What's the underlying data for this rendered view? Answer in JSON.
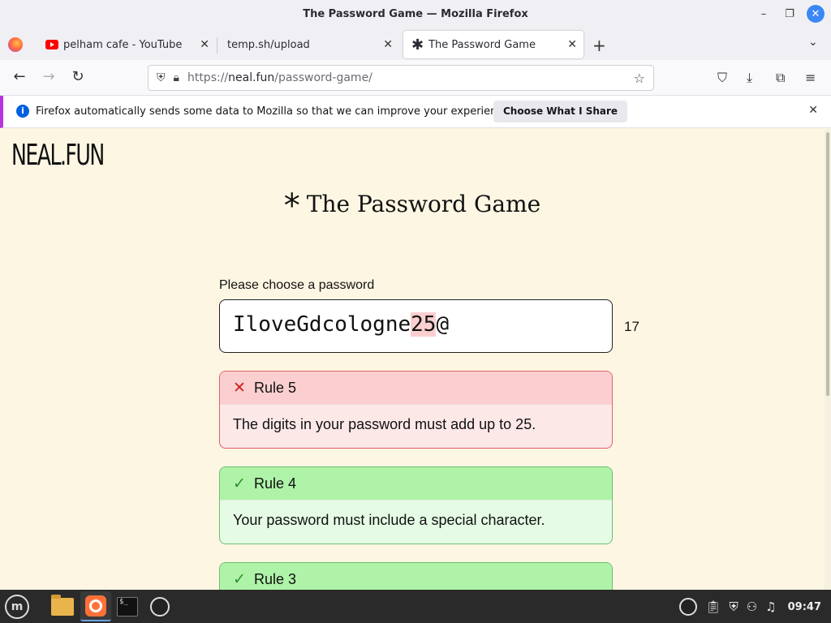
{
  "window": {
    "title": "The Password Game — Mozilla Firefox",
    "minimize": "–",
    "restore": "❐",
    "close": "✕"
  },
  "tabs": [
    {
      "title": "pelham cafe - YouTube",
      "icon": "youtube-icon",
      "close": "✕"
    },
    {
      "title": "temp.sh/upload",
      "icon": "none",
      "close": "✕"
    },
    {
      "title": "The Password Game",
      "icon": "asterisk-icon",
      "close": "✕",
      "active": true
    }
  ],
  "tabbar": {
    "new_tab": "+",
    "tab_list": "⌄"
  },
  "nav": {
    "back": "←",
    "forward": "→",
    "reload": "↻",
    "url_scheme": "https://",
    "url_host": "neal.fun",
    "url_path": "/password-game/",
    "bookmark": "☆",
    "pocket": "⛉",
    "downloads": "⤓",
    "extensions": "⧉",
    "menu": "≡"
  },
  "notification": {
    "icon": "i",
    "text": "Firefox automatically sends some data to Mozilla so that we can improve your experience.",
    "button": "Choose What I Share",
    "close": "✕"
  },
  "page": {
    "logo": "NEAL.FUN",
    "title_icon": "*",
    "title": "The Password Game",
    "password_label": "Please choose a password",
    "password_prefix": "IloveGdcologne",
    "password_highlight": "25",
    "password_suffix": "@",
    "password_length": "17",
    "rules": [
      {
        "status": "fail",
        "icon": "✕",
        "name": "Rule 5",
        "text": "The digits in your password must add up to 25."
      },
      {
        "status": "pass",
        "icon": "✓",
        "name": "Rule 4",
        "text": "Your password must include a special character."
      },
      {
        "status": "pass",
        "icon": "✓",
        "name": "Rule 3",
        "text": ""
      }
    ]
  },
  "taskbar": {
    "start": "m",
    "terminal_prompt": "$_",
    "tray_icons": [
      "obs-icon",
      "clipboard-icon",
      "shield-icon",
      "network-icon",
      "music-icon"
    ],
    "clock": "09:47"
  },
  "colors": {
    "page_bg": "#fdf6e3",
    "rule_fail_header": "#fbcfd0",
    "rule_pass_header": "#aef3a8",
    "accent_blue": "#3b88f5"
  }
}
